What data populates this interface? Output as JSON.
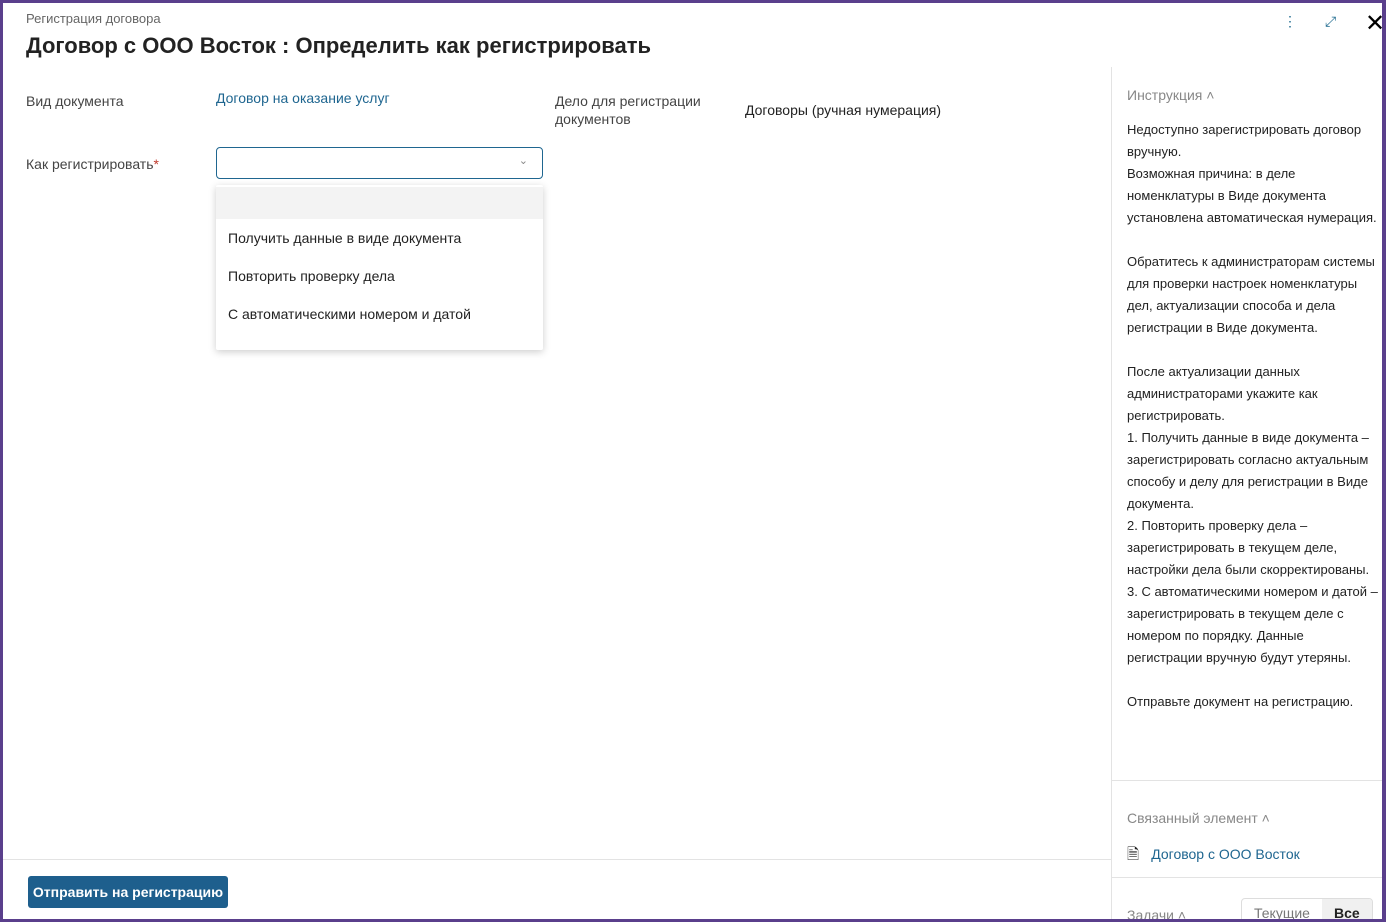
{
  "header": {
    "breadcrumb": "Регистрация договора",
    "title": "Договор  с ООО Восток : Определить как регистрировать"
  },
  "form": {
    "doc_type_label": "Вид документа",
    "doc_type_value": "Договор на оказание услуг",
    "case_label": "Дело для регистрации документов",
    "case_value": "Договоры (ручная нумерация)",
    "how_label": "Как регистрировать",
    "required_mark": "*",
    "options": [
      "Получить данные в виде документа",
      "Повторить проверку дела",
      "С автоматическими номером и датой"
    ]
  },
  "footer": {
    "submit": "Отправить на регистрацию"
  },
  "sidebar": {
    "instruction_title": "Инструкция",
    "instruction_text": "Недоступно зарегистрировать договор вручную.\nВозможная причина: в деле номенклатуры в Виде документа установлена автоматическая нумерация.\n\nОбратитесь к администраторам системы для проверки настроек номенклатуры дел, актуализации способа и дела регистрации в Виде документа.\n\nПосле актуализации данных администраторами укажите как регистрировать.\n1. Получить данные в виде документа – зарегистрировать согласно актуальным способу и делу для регистрации в Виде документа.\n2. Повторить проверку дела – зарегистрировать в текущем деле, настройки дела были скорректированы.\n3. С автоматическими номером и датой – зарегистрировать в текущем деле с номером по порядку. Данные регистрации вручную будут утеряны.\n\nОтправьте документ на регистрацию.",
    "linked_title": "Связанный элемент",
    "linked_item": "Договор с ООО Восток",
    "tasks_title": "Задачи",
    "tasks_current": "Текущие",
    "tasks_all": "Все"
  },
  "colors": {
    "accent": "#1e5f8d",
    "frame": "#5a3f8c"
  }
}
